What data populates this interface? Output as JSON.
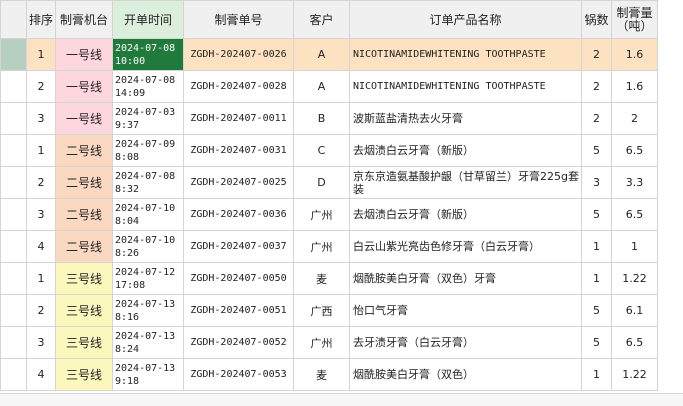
{
  "columns": {
    "seq": "排序",
    "machine": "制膏机台",
    "start_time": "开单时间",
    "order_no": "制膏单号",
    "customer": "客户",
    "product": "订单产品名称",
    "pots": "锅数",
    "qty": "制膏量\n（吨）"
  },
  "rows": [
    {
      "seq": "1",
      "machine": "一号线",
      "time": "2024-07-08 10:00",
      "order_no": "ZGDH-202407-0026",
      "customer": "A",
      "product": "NICOTINAMIDEWHITENING TOOTHPASTE",
      "pots": "2",
      "qty": "1.6"
    },
    {
      "seq": "2",
      "machine": "一号线",
      "time": "2024-07-08 14:09",
      "order_no": "ZGDH-202407-0028",
      "customer": "A",
      "product": "NICOTINAMIDEWHITENING TOOTHPASTE",
      "pots": "2",
      "qty": "1.6"
    },
    {
      "seq": "3",
      "machine": "一号线",
      "time": "2024-07-03 9:37",
      "order_no": "ZGDH-202407-0011",
      "customer": "B",
      "product": "波斯蓝盐清热去火牙膏",
      "pots": "2",
      "qty": "2"
    },
    {
      "seq": "1",
      "machine": "二号线",
      "time": "2024-07-09 8:08",
      "order_no": "ZGDH-202407-0031",
      "customer": "C",
      "product": "去烟渍白云牙膏（新版）",
      "pots": "5",
      "qty": "6.5"
    },
    {
      "seq": "2",
      "machine": "二号线",
      "time": "2024-07-08 8:32",
      "order_no": "ZGDH-202407-0025",
      "customer": "D",
      "product": "京东京造氨基酸护龈（甘草留兰）牙膏225g套装",
      "pots": "3",
      "qty": "3.3"
    },
    {
      "seq": "3",
      "machine": "二号线",
      "time": "2024-07-10 8:04",
      "order_no": "ZGDH-202407-0036",
      "customer": "广州",
      "product": "去烟渍白云牙膏（新版）",
      "pots": "5",
      "qty": "6.5"
    },
    {
      "seq": "4",
      "machine": "二号线",
      "time": "2024-07-10 8:26",
      "order_no": "ZGDH-202407-0037",
      "customer": "广州",
      "product": "白云山紫光亮齿色修牙膏（白云牙膏）",
      "pots": "1",
      "qty": "1"
    },
    {
      "seq": "1",
      "machine": "三号线",
      "time": "2024-07-12 17:08",
      "order_no": "ZGDH-202407-0050",
      "customer": "麦",
      "product": "烟酰胺美白牙膏（双色）牙膏",
      "pots": "1",
      "qty": "1.22"
    },
    {
      "seq": "2",
      "machine": "三号线",
      "time": "2024-07-13 8:16",
      "order_no": "ZGDH-202407-0051",
      "customer": "广西",
      "product": "怡口气牙膏",
      "pots": "5",
      "qty": "6.1"
    },
    {
      "seq": "3",
      "machine": "三号线",
      "time": "2024-07-13 8:24",
      "order_no": "ZGDH-202407-0052",
      "customer": "广州",
      "product": "去牙渍牙膏（白云牙膏）",
      "pots": "5",
      "qty": "6.5"
    },
    {
      "seq": "4",
      "machine": "三号线",
      "time": "2024-07-13 9:18",
      "order_no": "ZGDH-202407-0053",
      "customer": "麦",
      "product": "烟酰胺美白牙膏（双色）",
      "pots": "1",
      "qty": "1.22"
    }
  ],
  "colors": {
    "line1": "#fdd6de",
    "line2": "#fbd9c1",
    "line3": "#fbf7bd",
    "selected_cell": "#1f7a3c",
    "selected_row": "#fde2c2",
    "active_header": "#dcefdc"
  }
}
